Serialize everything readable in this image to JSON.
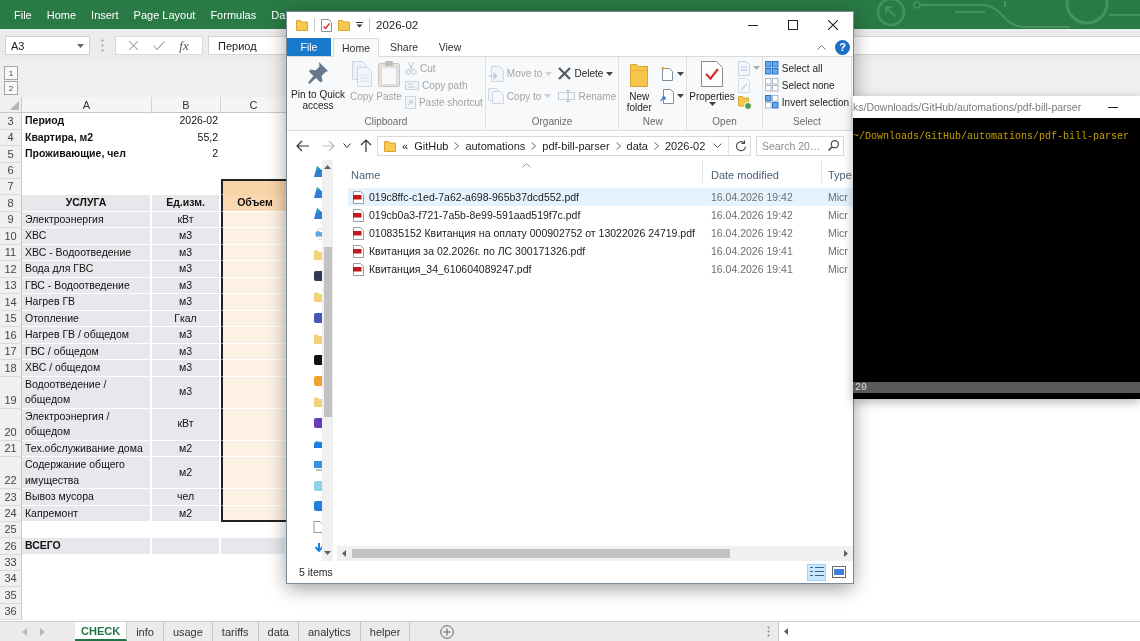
{
  "excel": {
    "ribbon_tabs": [
      {
        "label": "File"
      },
      {
        "label": "Home"
      },
      {
        "label": "Insert"
      },
      {
        "label": "Page Layout"
      },
      {
        "label": "Formulas"
      },
      {
        "label": "Da"
      }
    ],
    "name_box": "A3",
    "function_label": "fx",
    "formula": "Период",
    "outline_levels": [
      "1",
      "2"
    ],
    "columns": [
      "A",
      "B",
      "C"
    ],
    "rows": [
      {
        "number": "3",
        "kind": "info",
        "label": "Период",
        "value": "2026-02"
      },
      {
        "number": "4",
        "kind": "info",
        "label": "Квартира, м2",
        "value": "55,2"
      },
      {
        "number": "5",
        "kind": "info",
        "label": "Проживающие, чел",
        "value": "2"
      },
      {
        "number": "6",
        "kind": "empty"
      },
      {
        "number": "7",
        "kind": "group_header"
      },
      {
        "number": "8",
        "kind": "table_header",
        "service": "УСЛУГА",
        "unit": "Ед.изм.",
        "volume": "Объем"
      },
      {
        "number": "9",
        "kind": "service",
        "service": "Электроэнергия",
        "unit": "кВт"
      },
      {
        "number": "10",
        "kind": "service",
        "service": "ХВС",
        "unit": "м3"
      },
      {
        "number": "11",
        "kind": "service",
        "service": "ХВС - Водоотведение",
        "unit": "м3"
      },
      {
        "number": "12",
        "kind": "service",
        "service": "Вода для ГВС",
        "unit": "м3"
      },
      {
        "number": "13",
        "kind": "service",
        "service": "ГВС - Водоотведение",
        "unit": "м3"
      },
      {
        "number": "14",
        "kind": "service",
        "service": "Нагрев ГВ",
        "unit": "м3"
      },
      {
        "number": "15",
        "kind": "service",
        "service": "Отопление",
        "unit": "Гкал"
      },
      {
        "number": "16",
        "kind": "service",
        "service": "Нагрев ГВ / общедом",
        "unit": "м3"
      },
      {
        "number": "17",
        "kind": "service",
        "service": "ГВС / общедом",
        "unit": "м3"
      },
      {
        "number": "18",
        "kind": "service",
        "service": "ХВС / общедом",
        "unit": "м3"
      },
      {
        "number": "19",
        "kind": "service",
        "service": "Водоотведение / общедом",
        "unit": "м3"
      },
      {
        "number": "20",
        "kind": "service",
        "service": "Электроэнергия / общедом",
        "unit": "кВт"
      },
      {
        "number": "21",
        "kind": "service",
        "service": "Тех.обслуживание дома",
        "unit": "м2"
      },
      {
        "number": "22",
        "kind": "service",
        "service": "Содержание общего имущества",
        "unit": "м2"
      },
      {
        "number": "23",
        "kind": "service",
        "service": "Вывоз мусора",
        "unit": "чел"
      },
      {
        "number": "24",
        "kind": "service",
        "service": "Капремонт",
        "unit": "м2"
      },
      {
        "number": "25",
        "kind": "empty"
      },
      {
        "number": "26",
        "kind": "total",
        "label": "ВСЕГО"
      },
      {
        "number": "33",
        "kind": "empty"
      },
      {
        "number": "34",
        "kind": "empty"
      },
      {
        "number": "35",
        "kind": "empty"
      },
      {
        "number": "36",
        "kind": "empty"
      }
    ],
    "sheet_tabs": [
      {
        "label": "CHECK",
        "selected": true
      },
      {
        "label": "info",
        "selected": false
      },
      {
        "label": "usage",
        "selected": false
      },
      {
        "label": "tariffs",
        "selected": false
      },
      {
        "label": "data",
        "selected": false
      },
      {
        "label": "analytics",
        "selected": false
      },
      {
        "label": "helper",
        "selected": false
      }
    ]
  },
  "explorer": {
    "title": "2026-02",
    "ribbon_tabs": [
      {
        "label": "File",
        "kind": "menu",
        "selected": false
      },
      {
        "label": "Home",
        "kind": "tab",
        "selected": true
      },
      {
        "label": "Share",
        "kind": "tab",
        "selected": false
      },
      {
        "label": "View",
        "kind": "tab",
        "selected": false
      }
    ],
    "help_label": "?",
    "ribbon_groups": [
      {
        "label": "Clipboard",
        "commands": [
          {
            "kind": "pin",
            "label": "Pin to Quick access",
            "disabled": false
          },
          {
            "kind": "copy",
            "label": "Copy",
            "disabled": true
          },
          {
            "kind": "paste",
            "label": "Paste",
            "disabled": true
          },
          {
            "kind": "cut",
            "label": "Cut",
            "disabled": true
          },
          {
            "kind": "copy_path",
            "label": "Copy path",
            "disabled": true
          },
          {
            "kind": "paste_shortcut",
            "label": "Paste shortcut",
            "disabled": true
          }
        ]
      },
      {
        "label": "Organize",
        "commands": [
          {
            "kind": "move_to",
            "label": "Move to",
            "disabled": true
          },
          {
            "kind": "copy_to",
            "label": "Copy to",
            "disabled": true
          },
          {
            "kind": "delete",
            "label": "Delete",
            "disabled": false
          },
          {
            "kind": "rename",
            "label": "Rename",
            "disabled": true
          }
        ]
      },
      {
        "label": "New",
        "commands": [
          {
            "kind": "new_folder",
            "label": "New folder",
            "disabled": false
          },
          {
            "kind": "new_item",
            "disabled": false
          },
          {
            "kind": "easy_access",
            "disabled": false
          }
        ]
      },
      {
        "label": "Open",
        "commands": [
          {
            "kind": "properties",
            "label": "Properties",
            "disabled": false
          },
          {
            "kind": "open",
            "disabled": true
          },
          {
            "kind": "edit",
            "disabled": true
          },
          {
            "kind": "history",
            "disabled": false
          }
        ]
      },
      {
        "label": "Select",
        "commands": [
          {
            "kind": "select_all",
            "label": "Select all",
            "disabled": false
          },
          {
            "kind": "select_none",
            "label": "Select none",
            "disabled": false
          },
          {
            "kind": "invert_selection",
            "label": "Invert selection",
            "disabled": false
          }
        ]
      }
    ],
    "nav_buttons": [
      {
        "kind": "back",
        "disabled": false
      },
      {
        "kind": "forward",
        "disabled": true
      },
      {
        "kind": "recent",
        "disabled": false
      },
      {
        "kind": "up",
        "disabled": false
      }
    ],
    "address": {
      "overflow": "«",
      "crumbs": [
        "GitHub",
        "automations",
        "pdf-bill-parser",
        "data",
        "2026-02"
      ]
    },
    "search_placeholder": "Search 20…",
    "columns": [
      {
        "label": "Name",
        "sorted": true
      },
      {
        "label": "Date modified",
        "sorted": false
      },
      {
        "label": "Type",
        "sorted": false
      }
    ],
    "files": [
      {
        "name": "019c8ffc-c1ed-7a62-a698-965b37dcd552.pdf",
        "date": "16.04.2026 19:42",
        "type": "Micr",
        "selected": true
      },
      {
        "name": "019cb0a3-f721-7a5b-8e99-591aad519f7c.pdf",
        "date": "16.04.2026 19:42",
        "type": "Micr",
        "selected": false
      },
      {
        "name": "010835152 Квитанция на оплату 000902752 от 13022026 24719.pdf",
        "date": "16.04.2026 19:42",
        "type": "Micr",
        "selected": false
      },
      {
        "name": "Квитанция за 02.2026г. по ЛС 300171326.pdf",
        "date": "16.04.2026 19:41",
        "type": "Micr",
        "selected": false
      },
      {
        "name": "Квитанция_34_610604089247.pdf",
        "date": "16.04.2026 19:41",
        "type": "Micr",
        "selected": false
      }
    ],
    "status": "5 items",
    "views": [
      {
        "kind": "details",
        "selected": true
      },
      {
        "kind": "large_icons",
        "selected": false
      }
    ]
  },
  "terminal": {
    "title": "ks/Downloads/GitHub/automations/pdf-bill-parser",
    "prompt": "~/Downloads/GitHub/automations/pdf-bill-parser",
    "status_line": "20"
  }
}
